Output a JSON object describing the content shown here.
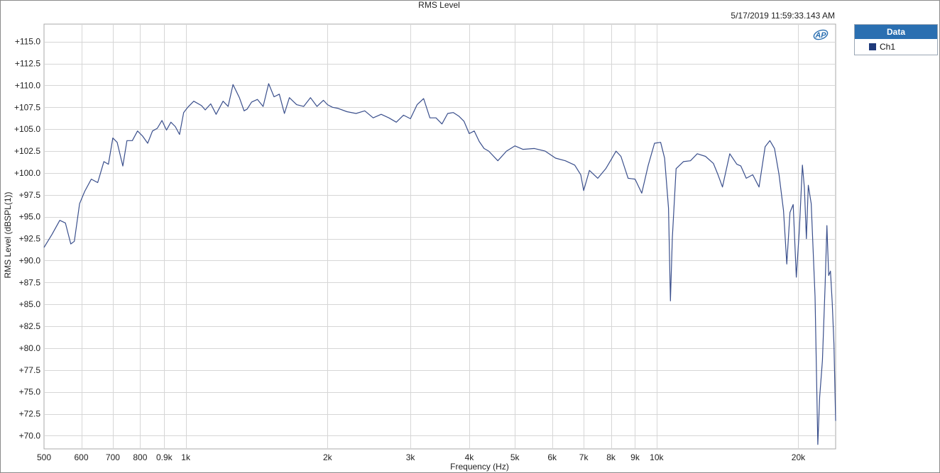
{
  "header": {
    "title": "RMS Level",
    "timestamp": "5/17/2019 11:59:33.143 AM"
  },
  "legend": {
    "title": "Data",
    "entries": [
      {
        "label": "Ch1",
        "color": "#1f3a7a"
      }
    ]
  },
  "logo": {
    "icon": "audio-precision-logo",
    "text": "AP",
    "color": "#2a6fb1"
  },
  "chart_data": {
    "type": "line",
    "title": "RMS Level",
    "xlabel": "Frequency (Hz)",
    "ylabel": "RMS Level (dBSPL(1))",
    "xscale": "log",
    "xlim": [
      500,
      24000
    ],
    "ylim": [
      68.5,
      117
    ],
    "grid": true,
    "legend_position": "right",
    "x_ticks": [
      {
        "value": 500,
        "label": "500"
      },
      {
        "value": 600,
        "label": "600"
      },
      {
        "value": 700,
        "label": "700"
      },
      {
        "value": 800,
        "label": "800"
      },
      {
        "value": 900,
        "label": "0.9k"
      },
      {
        "value": 1000,
        "label": "1k"
      },
      {
        "value": 2000,
        "label": "2k"
      },
      {
        "value": 3000,
        "label": "3k"
      },
      {
        "value": 4000,
        "label": "4k"
      },
      {
        "value": 5000,
        "label": "5k"
      },
      {
        "value": 6000,
        "label": "6k"
      },
      {
        "value": 7000,
        "label": "7k"
      },
      {
        "value": 8000,
        "label": "8k"
      },
      {
        "value": 9000,
        "label": "9k"
      },
      {
        "value": 10000,
        "label": "10k"
      },
      {
        "value": 20000,
        "label": "20k"
      }
    ],
    "y_ticks": [
      {
        "value": 115.0,
        "label": "+115.0"
      },
      {
        "value": 112.5,
        "label": "+112.5"
      },
      {
        "value": 110.0,
        "label": "+110.0"
      },
      {
        "value": 107.5,
        "label": "+107.5"
      },
      {
        "value": 105.0,
        "label": "+105.0"
      },
      {
        "value": 102.5,
        "label": "+102.5"
      },
      {
        "value": 100.0,
        "label": "+100.0"
      },
      {
        "value": 97.5,
        "label": "+97.5"
      },
      {
        "value": 95.0,
        "label": "+95.0"
      },
      {
        "value": 92.5,
        "label": "+92.5"
      },
      {
        "value": 90.0,
        "label": "+90.0"
      },
      {
        "value": 87.5,
        "label": "+87.5"
      },
      {
        "value": 85.0,
        "label": "+85.0"
      },
      {
        "value": 82.5,
        "label": "+82.5"
      },
      {
        "value": 80.0,
        "label": "+80.0"
      },
      {
        "value": 77.5,
        "label": "+77.5"
      },
      {
        "value": 75.0,
        "label": "+75.0"
      },
      {
        "value": 72.5,
        "label": "+72.5"
      },
      {
        "value": 70.0,
        "label": "+70.0"
      }
    ],
    "series": [
      {
        "name": "Ch1",
        "color": "#3a4f8c",
        "points": [
          [
            500,
            91.5
          ],
          [
            520,
            93.0
          ],
          [
            540,
            94.6
          ],
          [
            555,
            94.3
          ],
          [
            570,
            91.9
          ],
          [
            580,
            92.2
          ],
          [
            595,
            96.5
          ],
          [
            610,
            97.9
          ],
          [
            630,
            99.3
          ],
          [
            650,
            98.9
          ],
          [
            670,
            101.3
          ],
          [
            685,
            101.0
          ],
          [
            700,
            104.0
          ],
          [
            715,
            103.5
          ],
          [
            735,
            100.8
          ],
          [
            750,
            103.7
          ],
          [
            770,
            103.7
          ],
          [
            790,
            104.8
          ],
          [
            810,
            104.2
          ],
          [
            830,
            103.4
          ],
          [
            850,
            104.8
          ],
          [
            870,
            105.1
          ],
          [
            890,
            106.0
          ],
          [
            910,
            104.9
          ],
          [
            930,
            105.8
          ],
          [
            950,
            105.3
          ],
          [
            970,
            104.4
          ],
          [
            990,
            106.9
          ],
          [
            1010,
            107.5
          ],
          [
            1040,
            108.2
          ],
          [
            1080,
            107.7
          ],
          [
            1100,
            107.2
          ],
          [
            1130,
            107.9
          ],
          [
            1160,
            106.7
          ],
          [
            1200,
            108.2
          ],
          [
            1230,
            107.6
          ],
          [
            1260,
            110.1
          ],
          [
            1300,
            108.6
          ],
          [
            1330,
            107.1
          ],
          [
            1350,
            107.3
          ],
          [
            1380,
            108.1
          ],
          [
            1420,
            108.4
          ],
          [
            1460,
            107.6
          ],
          [
            1500,
            110.2
          ],
          [
            1540,
            108.7
          ],
          [
            1580,
            109.0
          ],
          [
            1620,
            106.8
          ],
          [
            1660,
            108.6
          ],
          [
            1720,
            107.8
          ],
          [
            1780,
            107.6
          ],
          [
            1840,
            108.6
          ],
          [
            1900,
            107.6
          ],
          [
            1960,
            108.3
          ],
          [
            2000,
            107.8
          ],
          [
            2050,
            107.5
          ],
          [
            2100,
            107.4
          ],
          [
            2200,
            107.0
          ],
          [
            2300,
            106.8
          ],
          [
            2400,
            107.1
          ],
          [
            2500,
            106.3
          ],
          [
            2600,
            106.7
          ],
          [
            2700,
            106.3
          ],
          [
            2800,
            105.8
          ],
          [
            2900,
            106.6
          ],
          [
            3000,
            106.2
          ],
          [
            3100,
            107.8
          ],
          [
            3200,
            108.5
          ],
          [
            3300,
            106.3
          ],
          [
            3400,
            106.3
          ],
          [
            3500,
            105.6
          ],
          [
            3600,
            106.8
          ],
          [
            3700,
            106.9
          ],
          [
            3800,
            106.5
          ],
          [
            3900,
            105.9
          ],
          [
            4000,
            104.5
          ],
          [
            4100,
            104.8
          ],
          [
            4200,
            103.6
          ],
          [
            4300,
            102.8
          ],
          [
            4400,
            102.5
          ],
          [
            4600,
            101.4
          ],
          [
            4800,
            102.5
          ],
          [
            5000,
            103.1
          ],
          [
            5200,
            102.7
          ],
          [
            5500,
            102.8
          ],
          [
            5800,
            102.5
          ],
          [
            6100,
            101.7
          ],
          [
            6400,
            101.4
          ],
          [
            6700,
            100.9
          ],
          [
            6900,
            99.8
          ],
          [
            7000,
            98.0
          ],
          [
            7200,
            100.3
          ],
          [
            7500,
            99.4
          ],
          [
            7800,
            100.5
          ],
          [
            8000,
            101.5
          ],
          [
            8200,
            102.5
          ],
          [
            8400,
            101.9
          ],
          [
            8700,
            99.4
          ],
          [
            9000,
            99.3
          ],
          [
            9300,
            97.7
          ],
          [
            9600,
            100.9
          ],
          [
            9900,
            103.4
          ],
          [
            10200,
            103.5
          ],
          [
            10400,
            101.7
          ],
          [
            10600,
            96.0
          ],
          [
            10700,
            85.4
          ],
          [
            10800,
            92.6
          ],
          [
            11000,
            100.5
          ],
          [
            11400,
            101.3
          ],
          [
            11800,
            101.4
          ],
          [
            12200,
            102.2
          ],
          [
            12700,
            101.9
          ],
          [
            13200,
            101.1
          ],
          [
            13500,
            99.8
          ],
          [
            13800,
            98.4
          ],
          [
            14300,
            102.2
          ],
          [
            14800,
            101.0
          ],
          [
            15100,
            100.8
          ],
          [
            15500,
            99.4
          ],
          [
            16000,
            99.8
          ],
          [
            16500,
            98.4
          ],
          [
            17000,
            103.0
          ],
          [
            17400,
            103.7
          ],
          [
            17800,
            102.8
          ],
          [
            18200,
            99.8
          ],
          [
            18600,
            95.7
          ],
          [
            18900,
            89.6
          ],
          [
            19200,
            95.5
          ],
          [
            19500,
            96.4
          ],
          [
            19800,
            88.1
          ],
          [
            20100,
            93.5
          ],
          [
            20400,
            100.9
          ],
          [
            20600,
            98.3
          ],
          [
            20800,
            92.5
          ],
          [
            21000,
            98.6
          ],
          [
            21300,
            96.5
          ],
          [
            21700,
            85.9
          ],
          [
            22000,
            69.0
          ],
          [
            22200,
            74.4
          ],
          [
            22500,
            78.6
          ],
          [
            22800,
            87.2
          ],
          [
            23000,
            94.0
          ],
          [
            23200,
            88.3
          ],
          [
            23400,
            88.8
          ],
          [
            23600,
            85.2
          ],
          [
            23800,
            80.5
          ],
          [
            24000,
            71.7
          ]
        ]
      }
    ]
  }
}
